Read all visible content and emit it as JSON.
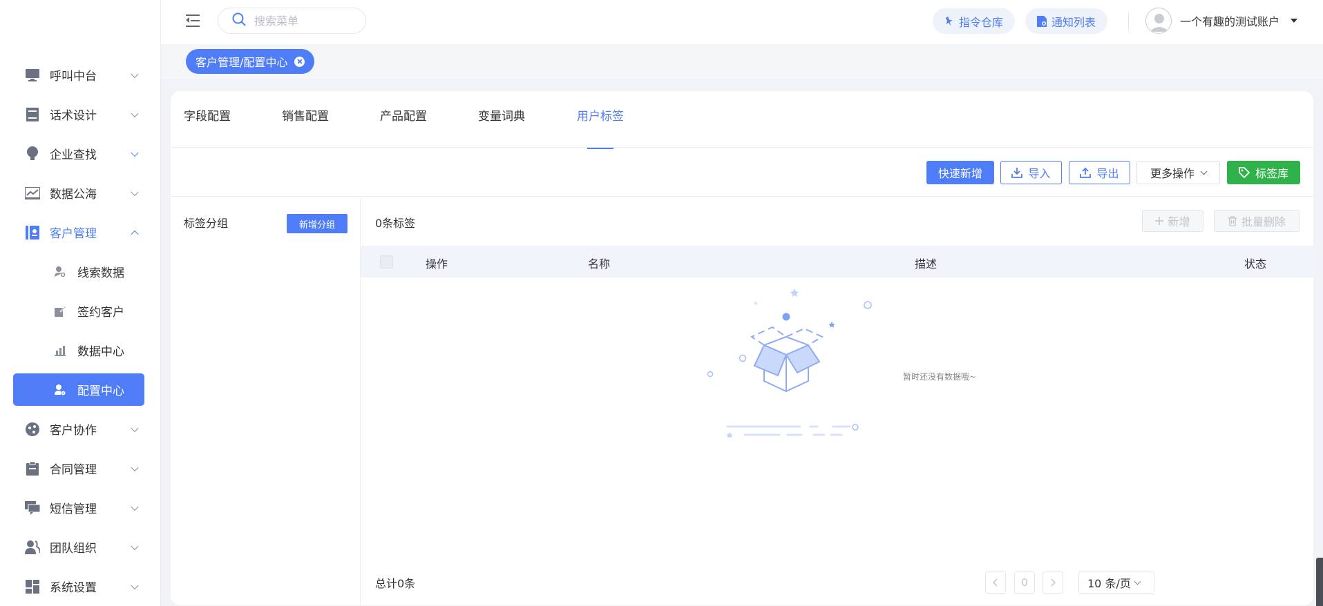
{
  "colors": {
    "accent": "#4f7cf7",
    "green": "#2fb24a"
  },
  "sidebar": {
    "items": [
      {
        "label": "呼叫中台",
        "icon": "monitor-icon"
      },
      {
        "label": "话术设计",
        "icon": "book-icon"
      },
      {
        "label": "企业查找",
        "icon": "bulb-icon"
      },
      {
        "label": "数据公海",
        "icon": "chart-icon"
      },
      {
        "label": "客户管理",
        "icon": "contacts-icon"
      },
      {
        "label": "客户协作",
        "icon": "collab-icon"
      },
      {
        "label": "合同管理",
        "icon": "clipboard-icon"
      },
      {
        "label": "短信管理",
        "icon": "message-icon"
      },
      {
        "label": "团队组织",
        "icon": "team-icon"
      },
      {
        "label": "系统设置",
        "icon": "grid-icon"
      }
    ],
    "subitems": [
      {
        "label": "线索数据",
        "icon": "user-search-icon"
      },
      {
        "label": "签约客户",
        "icon": "edit-icon"
      },
      {
        "label": "数据中心",
        "icon": "bar-chart-icon"
      },
      {
        "label": "配置中心",
        "icon": "user-gear-icon"
      }
    ]
  },
  "header": {
    "search_placeholder": "搜索菜单",
    "command_repo": "指令仓库",
    "notice_list": "通知列表",
    "username": "一个有趣的测试账户"
  },
  "route_tag": "客户管理/配置中心",
  "tabs": [
    "字段配置",
    "销售配置",
    "产品配置",
    "变量词典",
    "用户标签"
  ],
  "toolbar": {
    "quick_add": "快速新增",
    "import": "导入",
    "export": "导出",
    "more_ops": "更多操作",
    "tag_library": "标签库"
  },
  "left_pane": {
    "title": "标签分组",
    "add_group": "新增分组"
  },
  "right_pane": {
    "count_label": "0条标签",
    "add": "新增",
    "batch_delete": "批量删除",
    "columns": [
      "操作",
      "名称",
      "描述",
      "状态"
    ],
    "empty_text": "暂时还没有数据哦~",
    "total": "总计0条",
    "page": "0",
    "page_size": "10 条/页"
  }
}
